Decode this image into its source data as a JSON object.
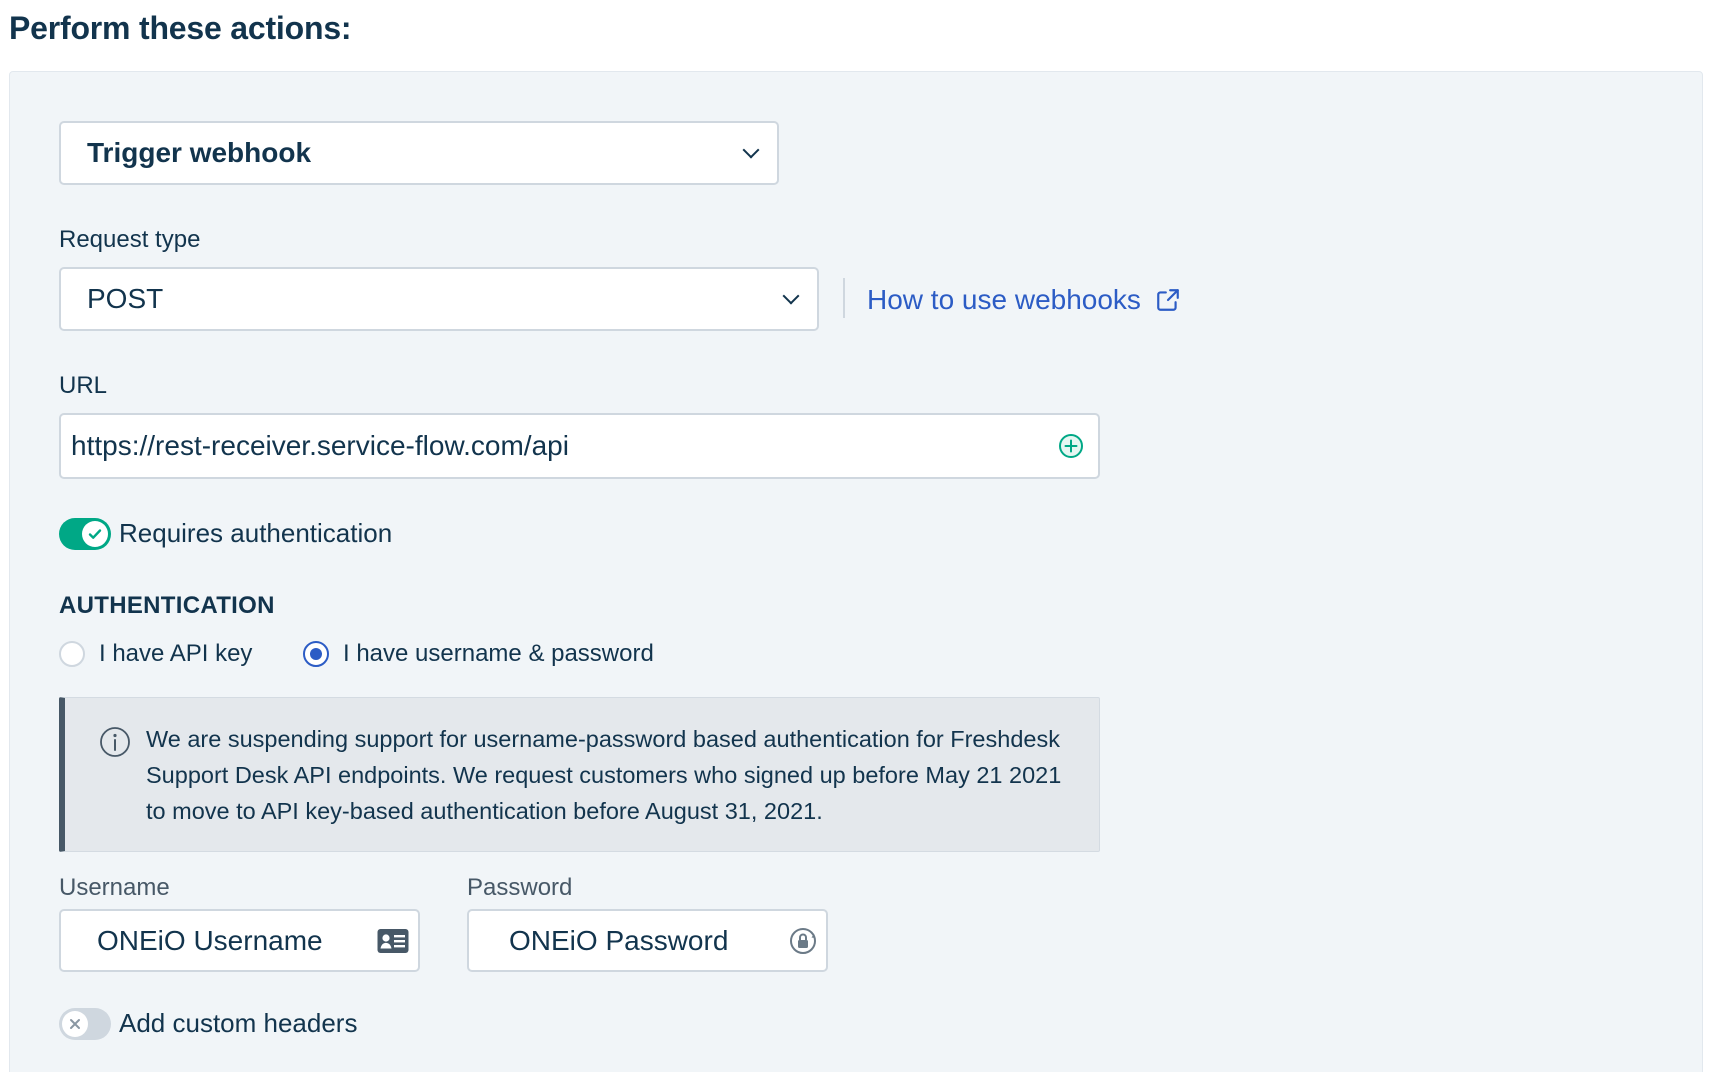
{
  "page": {
    "title": "Perform these actions:"
  },
  "action": {
    "selected": "Trigger webhook"
  },
  "request_type": {
    "label": "Request type",
    "selected": "POST"
  },
  "help_link": {
    "label": "How to use webhooks",
    "icon": "external-link-icon"
  },
  "url": {
    "label": "URL",
    "value": "https://rest-receiver.service-flow.com/api",
    "add_icon": "plus-circle-icon"
  },
  "requires_auth": {
    "label": "Requires authentication",
    "enabled": true
  },
  "authentication": {
    "heading": "AUTHENTICATION",
    "options": [
      {
        "label": "I have API key",
        "checked": false
      },
      {
        "label": "I have username & password",
        "checked": true
      }
    ],
    "notice": "We are suspending support for username-password based authentication for Freshdesk Support Desk API endpoints. We request customers who signed up before May 21 2021 to move to API key-based authentication before August 31, 2021."
  },
  "credentials": {
    "username_label": "Username",
    "username_value": "ONEiO Username",
    "password_label": "Password",
    "password_value": "ONEiO Password"
  },
  "custom_headers": {
    "label": "Add custom headers",
    "enabled": false
  },
  "colors": {
    "accent_blue": "#2c5cc5",
    "toggle_on": "#00a886",
    "toggle_off": "#cfd7df",
    "text": "#12344d"
  }
}
